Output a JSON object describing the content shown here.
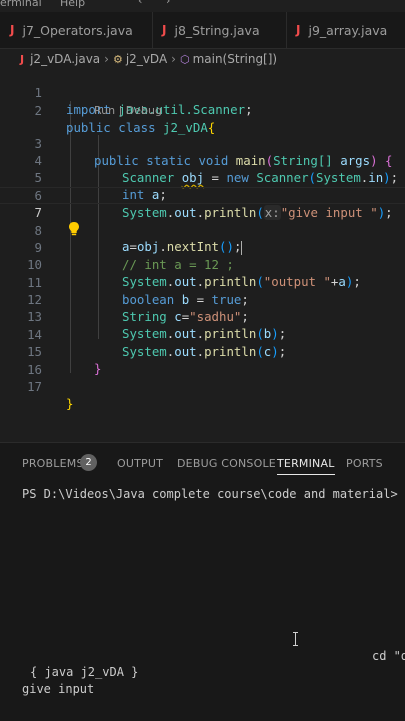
{
  "menubar": {
    "items": [
      "erminal",
      "Help"
    ]
  },
  "tabs": [
    {
      "label": "j7_Operators.java"
    },
    {
      "label": "j8_String.java"
    },
    {
      "label": "j9_array.java"
    }
  ],
  "breadcrumb": {
    "file": "j2_vDA.java",
    "class": "j2_vDA",
    "method": "main(String[])"
  },
  "codelens": "Run | Debug",
  "line_numbers": [
    "1",
    "2",
    "3",
    "4",
    "5",
    "6",
    "7",
    "8",
    "9",
    "10",
    "11",
    "12",
    "13",
    "14",
    "15",
    "16",
    "17"
  ],
  "code": {
    "l1": {
      "import": "import",
      "path": "java.util.Scanner",
      "semi": ";"
    },
    "l2": {
      "public": "public",
      "class": "class",
      "name": "j2_vDA",
      "brace": "{"
    },
    "l3": {
      "public": "public",
      "static": "static",
      "void": "void",
      "main": "main",
      "paren_open": "(",
      "type": "String[]",
      "args": "args",
      "paren_close": ")",
      "brace": "{"
    },
    "l4": {
      "type": "Scanner",
      "var": "obj",
      "eq": " = ",
      "new": "new",
      "ctor": "Scanner",
      "open": "(",
      "sys": "System",
      "dot": ".",
      "in": "in",
      "close": ")",
      "semi": ";"
    },
    "l5": {
      "int": "int",
      "var": "a",
      "semi": ";"
    },
    "l6": {
      "sys": "System",
      "dot1": ".",
      "out": "out",
      "dot2": ".",
      "fn": "println",
      "open": "(",
      "hint": "x:",
      "str": "\"give input \"",
      "close": ")",
      "semi": ";"
    },
    "l7": {
      "var": "a",
      "eq": "=",
      "obj": "obj",
      "dot": ".",
      "fn": "nextInt",
      "parens": "()",
      "semi": ";"
    },
    "l9": {
      "comment": "// int a = 12 ;"
    },
    "l10": {
      "sys": "System",
      "dot1": ".",
      "out": "out",
      "dot2": ".",
      "fn": "println",
      "open": "(",
      "str": "\"output \"",
      "plus": "+",
      "var": "a",
      "close": ")",
      "semi": ";"
    },
    "l11": {
      "type": "boolean",
      "var": "b",
      "eq": " = ",
      "val": "true",
      "semi": ";"
    },
    "l12": {
      "type": "String",
      "var": "c",
      "eq": "=",
      "str": "\"sadhu\"",
      "semi": ";"
    },
    "l13": {
      "sys": "System",
      "dot1": ".",
      "out": "out",
      "dot2": ".",
      "fn": "println",
      "open": "(",
      "var": "b",
      "close": ")",
      "semi": ";"
    },
    "l14": {
      "sys": "System",
      "dot1": ".",
      "out": "out",
      "dot2": ".",
      "fn": "println",
      "open": "(",
      "var": "c",
      "close": ")",
      "semi": ";"
    },
    "l15": {
      "brace": "}"
    },
    "l17": {
      "brace": "}"
    }
  },
  "panel": {
    "tabs": [
      "PROBLEMS",
      "OUTPUT",
      "DEBUG CONSOLE",
      "TERMINAL",
      "PORTS"
    ],
    "problems_count": "2",
    "active_tab": "TERMINAL"
  },
  "terminal": {
    "prompt_line": "PS D:\\Videos\\Java complete course\\code and material> cd",
    "wrap_fragment": "cd \"d",
    "run_line": "{ java j2_vDA }",
    "output_line": "give input"
  },
  "colors": {
    "editor_bg": "#1e1e1e",
    "panel_bg": "#181818",
    "java_icon": "#f14c4c",
    "keyword": "#569cd6",
    "type": "#4ec9b0",
    "string": "#ce9178"
  }
}
